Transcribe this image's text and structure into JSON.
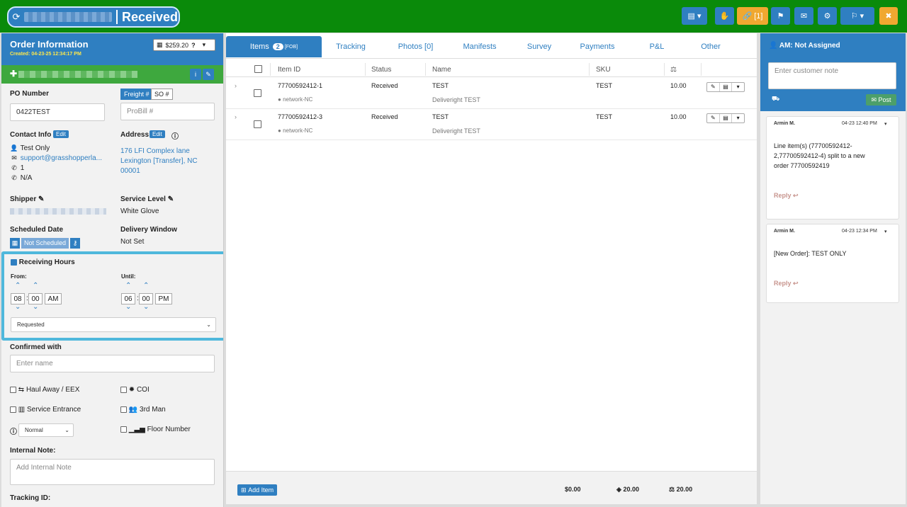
{
  "header": {
    "status": "Received",
    "colors": {
      "bar": "#0a8a0a",
      "primary": "#2f7fc1",
      "warning": "#f0a830"
    },
    "buttons": {
      "document": "▤ ▾",
      "hand": "✋",
      "link": "🔗 [1]",
      "flag": "⚑",
      "mail": "✉",
      "settings": "⚙",
      "route": "⚐ ▾",
      "close": "✖"
    }
  },
  "left": {
    "title": "Order Information",
    "created": "Created: 04-23-25 12:34:17 PM",
    "price": "$259.20",
    "po_label": "PO Number",
    "po_value": "0422TEST",
    "freight_tab": "Freight #",
    "so_tab": "SO #",
    "probill_placeholder": "ProBill #",
    "contact_label": "Contact Info",
    "edit": "Edit",
    "address_label": "Address",
    "contact_name": "Test Only",
    "contact_email": "support@grasshopperla...",
    "contact_phone1": "1",
    "contact_phone2": "N/A",
    "address_line1": "176 LFI Complex lane",
    "address_line2": "Lexington [Transfer], NC",
    "address_line3": "00001",
    "shipper_label": "Shipper",
    "service_level_label": "Service Level",
    "service_level_value": "White Glove",
    "scheduled_label": "Scheduled Date",
    "not_scheduled": "Not Scheduled",
    "delivery_window_label": "Delivery Window",
    "delivery_window_value": "Not Set",
    "receiving_hours_label": "Receiving Hours",
    "from_label": "From:",
    "until_label": "Until:",
    "from_hour": "08",
    "from_min": "00",
    "from_ampm": "AM",
    "until_hour": "06",
    "until_min": "00",
    "until_ampm": "PM",
    "requested": "Requested",
    "confirmed_label": "Confirmed with",
    "confirmed_placeholder": "Enter name",
    "haul_away": "Haul Away / EEX",
    "coi": "COI",
    "service_entrance": "Service Entrance",
    "third_man": "3rd Man",
    "priority": "Normal",
    "floor_number": "Floor Number",
    "internal_note_label": "Internal Note:",
    "internal_note_placeholder": "Add Internal Note",
    "tracking_label": "Tracking ID:"
  },
  "tabs": {
    "items": "Items",
    "items_count": "2",
    "items_fob": "[FOB]",
    "tracking": "Tracking",
    "photos": "Photos [0]",
    "manifests": "Manifests",
    "survey": "Survey",
    "payments": "Payments",
    "pl": "P&L",
    "other": "Other"
  },
  "table": {
    "headers": {
      "item_id": "Item ID",
      "status": "Status",
      "name": "Name",
      "sku": "SKU",
      "weight_icon": "⚖"
    },
    "rows": [
      {
        "item_id": "77700592412-1",
        "location": "network-NC",
        "status": "Received",
        "name": "TEST",
        "sub": "Deliveright TEST",
        "sku": "TEST",
        "weight": "10.00"
      },
      {
        "item_id": "77700592412-3",
        "location": "network-NC",
        "status": "Received",
        "name": "TEST",
        "sub": "Deliveright TEST",
        "sku": "TEST",
        "weight": "10.00"
      }
    ],
    "add_item": "Add Item",
    "total_price": "$0.00",
    "total_cube": "20.00",
    "total_weight": "20.00"
  },
  "right": {
    "am": "AM: Not Assigned",
    "note_placeholder": "Enter customer note",
    "post": "Post",
    "comments": [
      {
        "author": "Armin M.",
        "time": "04-23 12:40 PM",
        "body": "Line item(s) (77700592412-2,77700592412-4) split to a new order 77700592419",
        "reply": "Reply"
      },
      {
        "author": "Armin M.",
        "time": "04-23 12:34 PM",
        "body": "[New Order]: TEST ONLY",
        "reply": "Reply"
      }
    ]
  }
}
